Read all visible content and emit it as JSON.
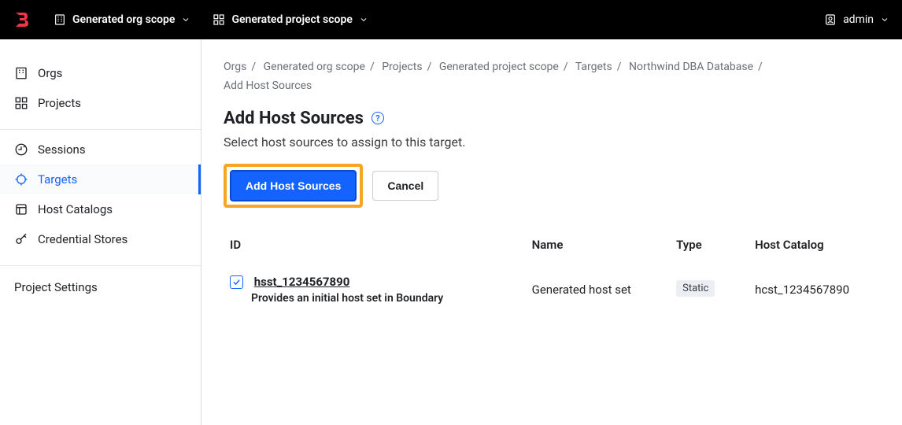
{
  "topbar": {
    "org_scope_label": "Generated org scope",
    "project_scope_label": "Generated project scope",
    "user_label": "admin"
  },
  "sidebar": {
    "items": [
      {
        "label": "Orgs"
      },
      {
        "label": "Projects"
      },
      {
        "label": "Sessions"
      },
      {
        "label": "Targets"
      },
      {
        "label": "Host Catalogs"
      },
      {
        "label": "Credential Stores"
      }
    ],
    "settings_label": "Project Settings"
  },
  "breadcrumb": {
    "parts": [
      "Orgs",
      "Generated org scope",
      "Projects",
      "Generated project scope",
      "Targets",
      "Northwind DBA Database",
      "Add Host Sources"
    ]
  },
  "page": {
    "title": "Add Host Sources",
    "subtitle": "Select host sources to assign to this target.",
    "primary_button": "Add Host Sources",
    "cancel_button": "Cancel"
  },
  "table": {
    "headers": {
      "id": "ID",
      "name": "Name",
      "type": "Type",
      "catalog": "Host Catalog"
    },
    "rows": [
      {
        "checked": true,
        "id": "hsst_1234567890",
        "desc": "Provides an initial host set in Boundary",
        "name": "Generated host set",
        "type": "Static",
        "catalog": "hcst_1234567890"
      }
    ]
  }
}
